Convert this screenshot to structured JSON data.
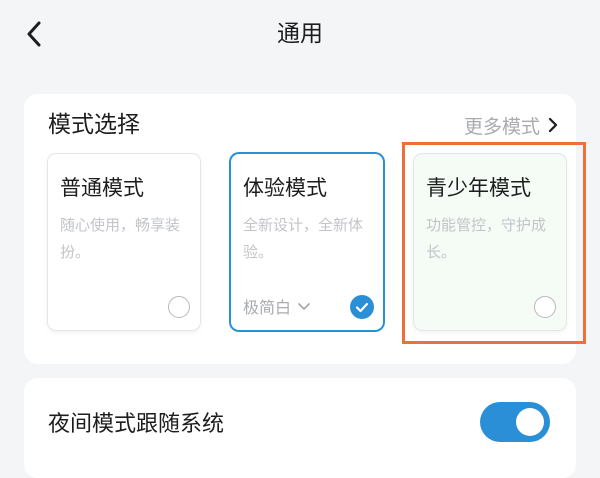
{
  "header": {
    "title": "通用"
  },
  "mode_section": {
    "title": "模式选择",
    "more_label": "更多模式",
    "options": [
      {
        "title": "普通模式",
        "desc": "随心使用，畅享装扮。",
        "selected": false
      },
      {
        "title": "体验模式",
        "desc": "全新设计，全新体验。",
        "sub_label": "极简白",
        "selected": true
      },
      {
        "title": "青少年模式",
        "desc": "功能管控，守护成长。",
        "selected": false
      }
    ]
  },
  "night_mode": {
    "label": "夜间模式跟随系统",
    "enabled": true
  },
  "colors": {
    "accent": "#2a8fd6",
    "highlight": "#ec6f3c"
  }
}
